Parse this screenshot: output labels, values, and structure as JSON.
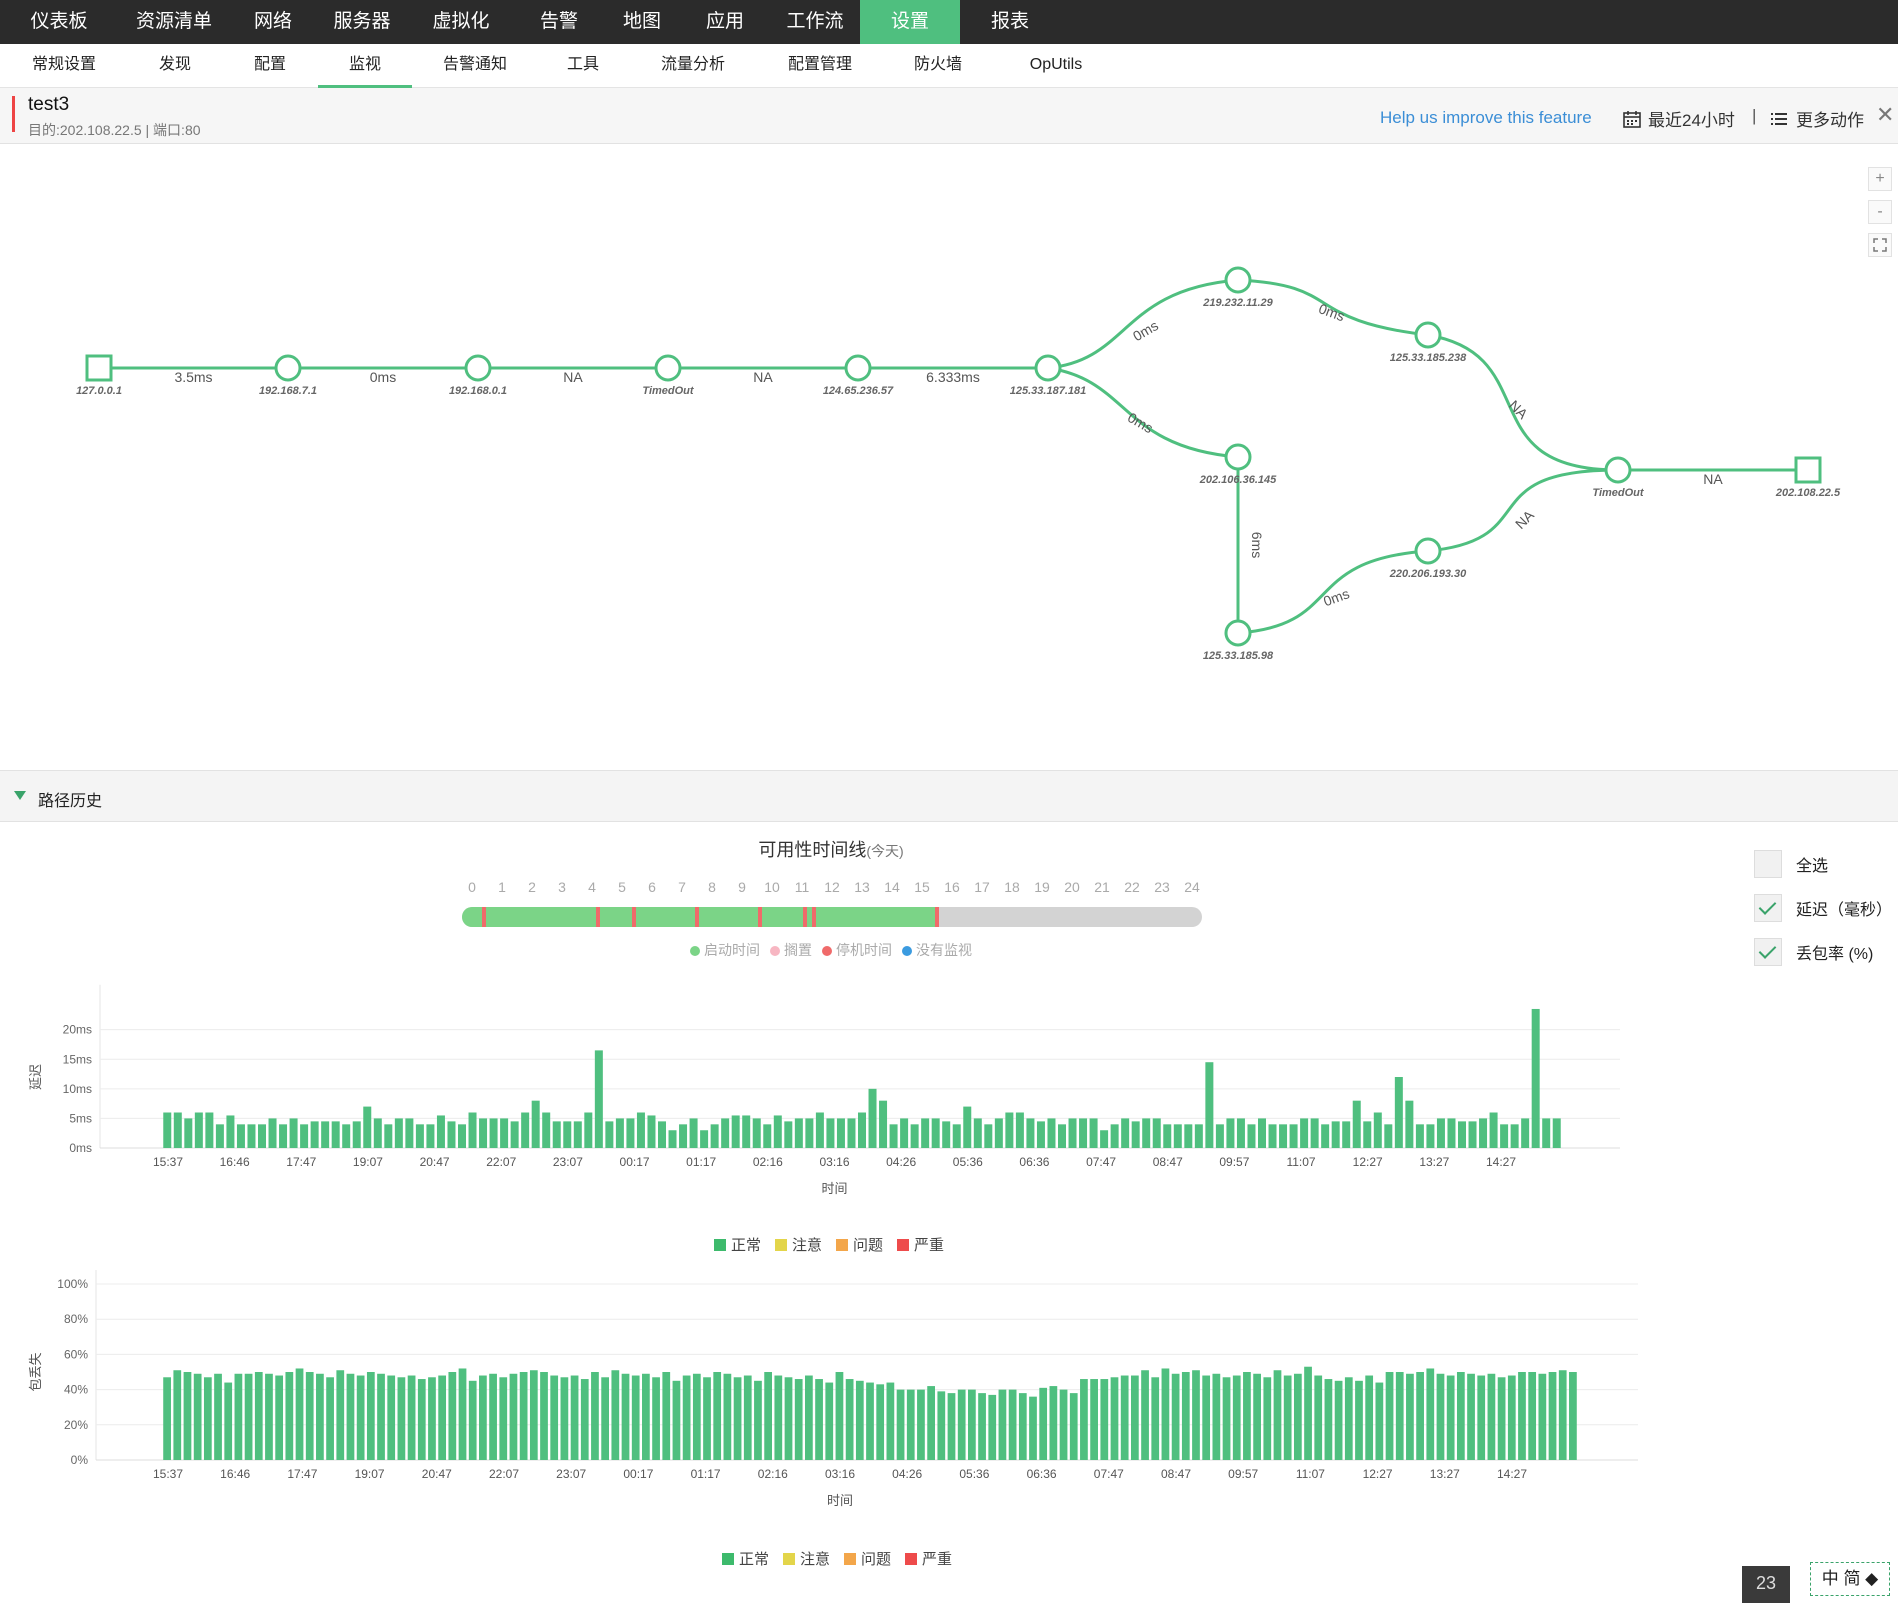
{
  "top_nav": [
    {
      "label": "仪表板",
      "active": false
    },
    {
      "label": "资源清单",
      "active": false
    },
    {
      "label": "网络",
      "active": false
    },
    {
      "label": "服务器",
      "active": false
    },
    {
      "label": "虚拟化",
      "active": false
    },
    {
      "label": "告警",
      "active": false
    },
    {
      "label": "地图",
      "active": false
    },
    {
      "label": "应用",
      "active": false
    },
    {
      "label": "工作流",
      "active": false
    },
    {
      "label": "设置",
      "active": true
    },
    {
      "label": "报表",
      "active": false
    }
  ],
  "sub_nav": [
    {
      "label": "常规设置",
      "active": false
    },
    {
      "label": "发现",
      "active": false
    },
    {
      "label": "配置",
      "active": false
    },
    {
      "label": "监视",
      "active": true
    },
    {
      "label": "告警通知",
      "active": false
    },
    {
      "label": "工具",
      "active": false
    },
    {
      "label": "流量分析",
      "active": false
    },
    {
      "label": "配置管理",
      "active": false
    },
    {
      "label": "防火墙",
      "active": false
    },
    {
      "label": "OpUtils",
      "active": false
    }
  ],
  "header": {
    "title": "test3",
    "subtitle": "目的:202.108.22.5 | 端口:80",
    "help_link": "Help us improve this feature",
    "time_range": "最近24小时",
    "separator": "|",
    "more_actions": "更多动作",
    "calendar_icon": "calendar-icon",
    "list_icon": "list-icon",
    "close_icon": "close-icon"
  },
  "map_controls": {
    "zoom_in": "+",
    "zoom_out": "-",
    "fit_icon": "fit-screen-icon"
  },
  "path_map": {
    "line_color": "#4fbf7f",
    "nodes": [
      {
        "id": "n1",
        "label": "127.0.0.1",
        "shape": "square"
      },
      {
        "id": "n2",
        "label": "192.168.7.1",
        "shape": "circle"
      },
      {
        "id": "n3",
        "label": "192.168.0.1",
        "shape": "circle"
      },
      {
        "id": "n4",
        "label": "TimedOut",
        "shape": "circle"
      },
      {
        "id": "n5",
        "label": "124.65.236.57",
        "shape": "circle"
      },
      {
        "id": "n6",
        "label": "125.33.187.181",
        "shape": "circle"
      },
      {
        "id": "n7",
        "label": "219.232.11.29",
        "shape": "circle"
      },
      {
        "id": "n8",
        "label": "125.33.185.238",
        "shape": "circle"
      },
      {
        "id": "n9",
        "label": "202.106.36.145",
        "shape": "circle"
      },
      {
        "id": "n10",
        "label": "125.33.185.98",
        "shape": "circle"
      },
      {
        "id": "n11",
        "label": "220.206.193.30",
        "shape": "circle"
      },
      {
        "id": "n12",
        "label": "TimedOut",
        "shape": "circle"
      },
      {
        "id": "n13",
        "label": "202.108.22.5",
        "shape": "square"
      }
    ],
    "links": [
      {
        "from": "n1",
        "to": "n2",
        "label": "3.5ms"
      },
      {
        "from": "n2",
        "to": "n3",
        "label": "0ms"
      },
      {
        "from": "n3",
        "to": "n4",
        "label": "NA"
      },
      {
        "from": "n4",
        "to": "n5",
        "label": "NA"
      },
      {
        "from": "n5",
        "to": "n6",
        "label": "6.333ms"
      },
      {
        "from": "n6",
        "to": "n7",
        "label": "0ms"
      },
      {
        "from": "n7",
        "to": "n8",
        "label": "0ms"
      },
      {
        "from": "n8",
        "to": "n12",
        "label": "NA"
      },
      {
        "from": "n6",
        "to": "n9",
        "label": "0ms"
      },
      {
        "from": "n9",
        "to": "n10",
        "label": "6ms"
      },
      {
        "from": "n10",
        "to": "n11",
        "label": "0ms"
      },
      {
        "from": "n11",
        "to": "n12",
        "label": "NA"
      },
      {
        "from": "n12",
        "to": "n13",
        "label": "NA"
      }
    ]
  },
  "history": {
    "label": "路径历史"
  },
  "availability": {
    "title": "可用性时间线",
    "title_suffix": "(今天)",
    "hours": [
      "0",
      "1",
      "2",
      "3",
      "4",
      "5",
      "6",
      "7",
      "8",
      "9",
      "10",
      "11",
      "12",
      "13",
      "14",
      "15",
      "16",
      "17",
      "18",
      "19",
      "20",
      "21",
      "22",
      "23",
      "24"
    ],
    "monitored_until_hour": 15.5,
    "downtime_hours": [
      0.4,
      4.2,
      5.4,
      7.5,
      9.6,
      11.1,
      11.4,
      15.5
    ],
    "legend": [
      {
        "label": "启动时间",
        "color": "#7bd487"
      },
      {
        "label": "搁置",
        "color": "#f7b6c2"
      },
      {
        "label": "停机时间",
        "color": "#f06a6a"
      },
      {
        "label": "没有监视",
        "color": "#3b9be0"
      }
    ]
  },
  "right_panel": {
    "items": [
      {
        "label": "全选",
        "checked": false
      },
      {
        "label": "延迟（毫秒）",
        "checked": true
      },
      {
        "label": "丢包率 (%)",
        "checked": true
      }
    ]
  },
  "status_legend": [
    {
      "label": "正常",
      "color": "#3dba6c"
    },
    {
      "label": "注意",
      "color": "#e3d54a"
    },
    {
      "label": "问题",
      "color": "#f3a64a"
    },
    {
      "label": "严重",
      "color": "#ee4b4b"
    }
  ],
  "chart_data": [
    {
      "type": "bar",
      "ylabel": "延迟",
      "xlabel": "时间",
      "yticks": [
        "0ms",
        "5ms",
        "10ms",
        "15ms",
        "20ms"
      ],
      "ylim": [
        0,
        24
      ],
      "x_tick_labels": [
        "15:37",
        "16:46",
        "17:47",
        "19:07",
        "20:47",
        "22:07",
        "23:07",
        "00:17",
        "01:17",
        "02:16",
        "03:16",
        "04:26",
        "05:36",
        "06:36",
        "07:47",
        "08:47",
        "09:57",
        "11:07",
        "12:27",
        "13:27",
        "14:27"
      ],
      "bar_color": "#4fbf7f",
      "values": [
        6,
        6,
        5,
        6,
        6,
        4,
        5.5,
        4,
        4,
        4,
        5,
        4,
        5,
        4,
        4.5,
        4.5,
        4.5,
        4,
        4.5,
        7,
        5,
        4,
        5,
        5,
        4,
        4,
        5.5,
        4.5,
        4,
        6,
        5,
        5,
        5,
        4.5,
        6,
        8,
        6,
        4.5,
        4.5,
        4.5,
        6,
        16.5,
        4.5,
        5,
        5,
        6,
        5.5,
        4.5,
        3,
        4,
        5,
        3,
        4,
        5,
        5.5,
        5.5,
        5,
        4,
        5.5,
        4.5,
        5,
        5,
        6,
        5,
        5,
        5,
        6,
        10,
        8,
        4,
        5,
        4,
        5,
        5,
        4.5,
        4,
        7,
        5,
        4,
        5,
        6,
        6,
        5,
        4.5,
        5,
        4,
        5,
        5,
        5,
        3,
        4,
        5,
        4.5,
        5,
        5,
        4,
        4,
        4,
        4,
        14.5,
        4,
        5,
        5,
        4,
        5,
        4,
        4,
        4,
        5,
        5,
        4,
        4.5,
        4.5,
        8,
        4.5,
        6,
        4,
        12,
        8,
        4,
        4,
        5,
        5,
        4.5,
        4.5,
        5,
        6,
        4,
        4,
        5,
        23.5,
        5,
        5
      ]
    },
    {
      "type": "bar",
      "ylabel": "包丢失",
      "xlabel": "时间",
      "yticks": [
        "0%",
        "20%",
        "40%",
        "60%",
        "80%",
        "100%"
      ],
      "ylim": [
        0,
        100
      ],
      "x_tick_labels": [
        "15:37",
        "16:46",
        "17:47",
        "19:07",
        "20:47",
        "22:07",
        "23:07",
        "00:17",
        "01:17",
        "02:16",
        "03:16",
        "04:26",
        "05:36",
        "06:36",
        "07:47",
        "08:47",
        "09:57",
        "11:07",
        "12:27",
        "13:27",
        "14:27"
      ],
      "bar_color": "#4fbf7f",
      "values": [
        47,
        51,
        50,
        49,
        47,
        49,
        44,
        49,
        49,
        50,
        49,
        48,
        50,
        52,
        50,
        49,
        47,
        51,
        49,
        48,
        50,
        49,
        48,
        47,
        48,
        46,
        47,
        48,
        50,
        52,
        45,
        48,
        49,
        47,
        49,
        50,
        51,
        50,
        48,
        47,
        48,
        46,
        50,
        47,
        51,
        49,
        48,
        49,
        47,
        50,
        45,
        48,
        49,
        47,
        50,
        49,
        47,
        48,
        45,
        50,
        48,
        47,
        46,
        48,
        46,
        44,
        50,
        46,
        45,
        44,
        43,
        44,
        40,
        40,
        40,
        42,
        39,
        38,
        40,
        40,
        38,
        37,
        40,
        40,
        38,
        36,
        41,
        42,
        40,
        38,
        46,
        46,
        46,
        47,
        48,
        48,
        51,
        47,
        52,
        49,
        50,
        51,
        48,
        49,
        47,
        48,
        50,
        49,
        47,
        51,
        48,
        49,
        53,
        48,
        46,
        45,
        47,
        45,
        48,
        44,
        50,
        50,
        49,
        50,
        52,
        49,
        48,
        50,
        49,
        48,
        49,
        47,
        48,
        50,
        50,
        49,
        50,
        51,
        50
      ]
    }
  ],
  "footer": {
    "badge_count": "23",
    "ime_text": "中 简 ◆"
  }
}
